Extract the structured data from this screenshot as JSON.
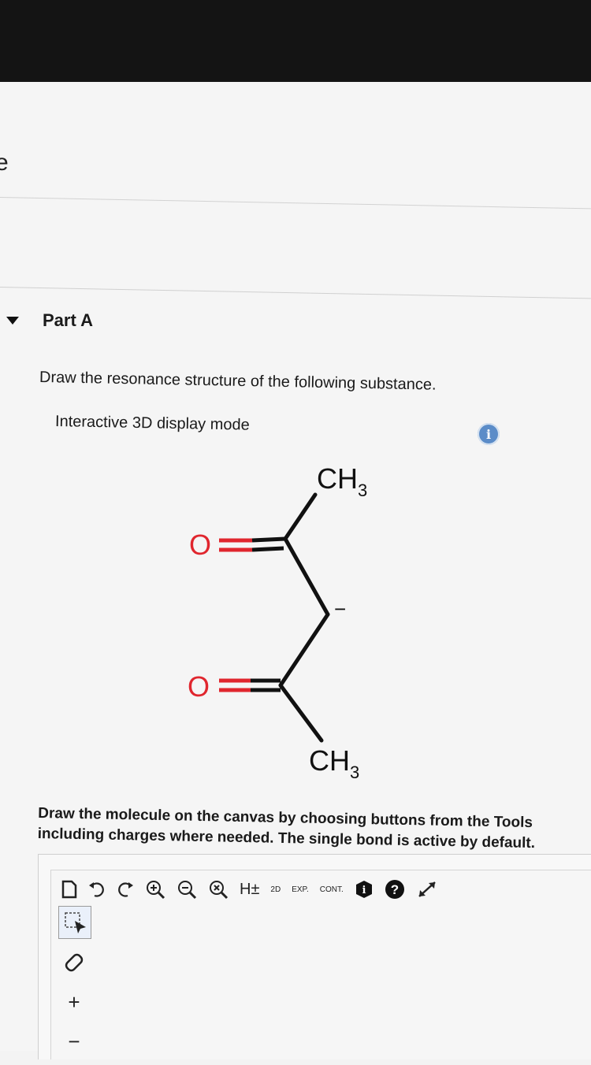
{
  "partA": {
    "title": "Part A",
    "question": "Draw the resonance structure of the following substance.",
    "display_mode": "Interactive 3D display mode",
    "info_icon": "i"
  },
  "molecule": {
    "top_group": "CH",
    "top_sub": "3",
    "bottom_group": "CH",
    "bottom_sub": "3",
    "oxygen_top": "O",
    "oxygen_bottom": "O",
    "charge": "−",
    "colors": {
      "oxygen": "#e0262e",
      "bond": "#111111"
    }
  },
  "instructions": {
    "line1": "Draw the molecule on the canvas by choosing buttons from the Tools",
    "line2": "including charges where needed. The single bond is active by default."
  },
  "toolbar": {
    "h_label": "H±",
    "twod_label": "2D",
    "exp_label": "EXP.",
    "cont_label": "CONT.",
    "icons": [
      "new-document-icon",
      "undo-icon",
      "redo-icon",
      "zoom-in-icon",
      "zoom-out-icon",
      "zoom-reset-icon",
      "h-toggle-icon",
      "2d-icon",
      "exp-icon",
      "cont-icon",
      "info-icon",
      "help-icon",
      "fullscreen-icon"
    ]
  },
  "left_tools": {
    "plus": "+",
    "minus": "−"
  }
}
